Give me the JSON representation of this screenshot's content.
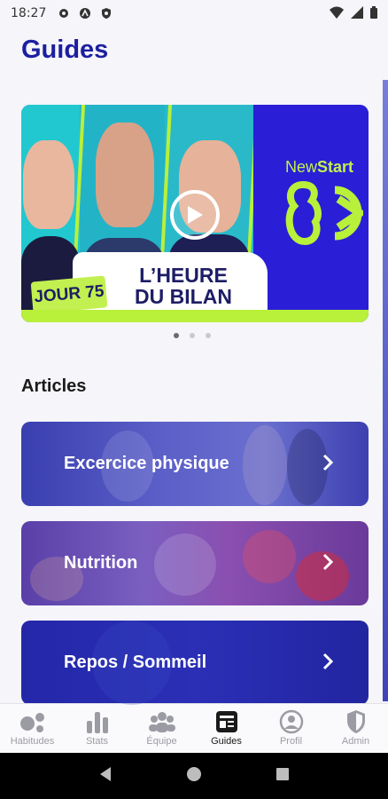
{
  "status_bar": {
    "time": "18:27",
    "icons_left": [
      "gear-icon",
      "at-icon",
      "shield-icon"
    ],
    "icons_right": [
      "wifi-icon",
      "signal-icon",
      "battery-icon"
    ]
  },
  "page": {
    "title": "Guides"
  },
  "hero": {
    "badge": "JOUR 75",
    "headline_line1": "L’HEURE",
    "headline_line2": "DU BILAN",
    "brand_light": "New",
    "brand_bold": "Start",
    "play_icon": "play-icon"
  },
  "carousel": {
    "count": 3,
    "active_index": 0
  },
  "articles": {
    "section_title": "Articles",
    "items": [
      {
        "label": "Excercice physique",
        "icon": "chevron-right-icon"
      },
      {
        "label": "Nutrition",
        "icon": "chevron-right-icon"
      },
      {
        "label": "Repos / Sommeil",
        "icon": "chevron-right-icon"
      }
    ]
  },
  "bottom_nav": {
    "items": [
      {
        "label": "Habitudes",
        "icon": "habits-icon"
      },
      {
        "label": "Stats",
        "icon": "stats-icon"
      },
      {
        "label": "Équipe",
        "icon": "team-icon"
      },
      {
        "label": "Guides",
        "icon": "guides-icon",
        "active": true
      },
      {
        "label": "Profil",
        "icon": "profile-icon"
      },
      {
        "label": "Admin",
        "icon": "admin-shield-icon"
      }
    ]
  },
  "colors": {
    "title": "#1c1fa0",
    "accent_lime": "#b8f03a",
    "brand_blue": "#2a1fd6",
    "nav_inactive": "#9b9ba3"
  }
}
